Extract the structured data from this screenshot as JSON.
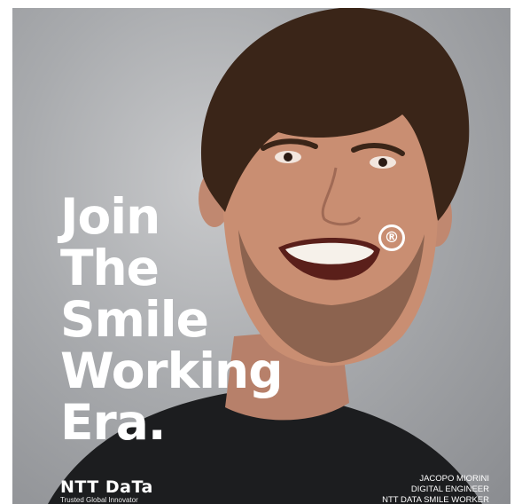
{
  "headline": {
    "lines": [
      "Join",
      "The",
      "Smile",
      "Working",
      "Era."
    ]
  },
  "registered_mark": "®",
  "logo": {
    "wordmark": "NTT DaTa",
    "tagline": "Trusted Global Innovator"
  },
  "credit": {
    "name": "JACOPO MIORINI",
    "role": "DIGITAL ENGINEER",
    "team": "NTT DATA SMILE WORKER"
  },
  "colors": {
    "background": "#a9abae",
    "text": "#ffffff",
    "shirt": "#1c1d1f",
    "hair": "#3a2518",
    "skin": "#c98e72"
  }
}
